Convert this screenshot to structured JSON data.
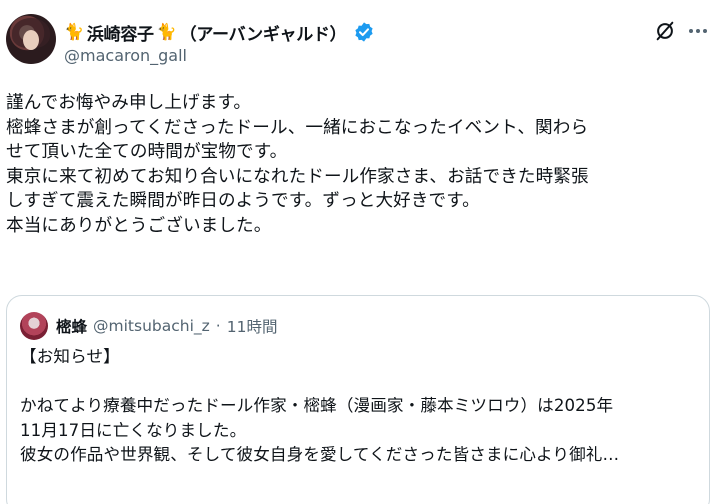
{
  "author": {
    "display_name": "浜崎容子",
    "display_name_suffix": "（アーバンギャルド）",
    "handle": "@macaron_gall",
    "verified": true
  },
  "icons": {
    "name_decoration": "cat-icon",
    "verified": "verified-badge-icon",
    "grok": "grok-icon",
    "more": "more-icon"
  },
  "colors": {
    "accent": "#1d9bf0",
    "secondary_text": "#536471",
    "border": "#cfd9de"
  },
  "post": {
    "lines": [
      "謹んでお悔やみ申し上げます。",
      "樒蜂さまが創ってくださったドール、一緒におこなったイベント、関わら",
      "せて頂いた全ての時間が宝物です。",
      "東京に来て初めてお知り合いになれたドール作家さま、お話できた時緊張",
      "しすぎて震えた瞬間が昨日のようです。ずっと大好きです。",
      "本当にありがとうございました。"
    ]
  },
  "quote": {
    "display_name": "樒蜂",
    "handle": "@mitsubachi_z",
    "separator": "·",
    "time": "11時間",
    "lines": [
      "【お知らせ】",
      "",
      "かねてより療養中だったドール作家・樒蜂（漫画家・藤本ミツロウ）は2025年",
      "11月17日に亡くなりました。",
      "彼女の作品や世界観、そして彼女自身を愛してくださった皆さまに心より御礼…"
    ]
  }
}
